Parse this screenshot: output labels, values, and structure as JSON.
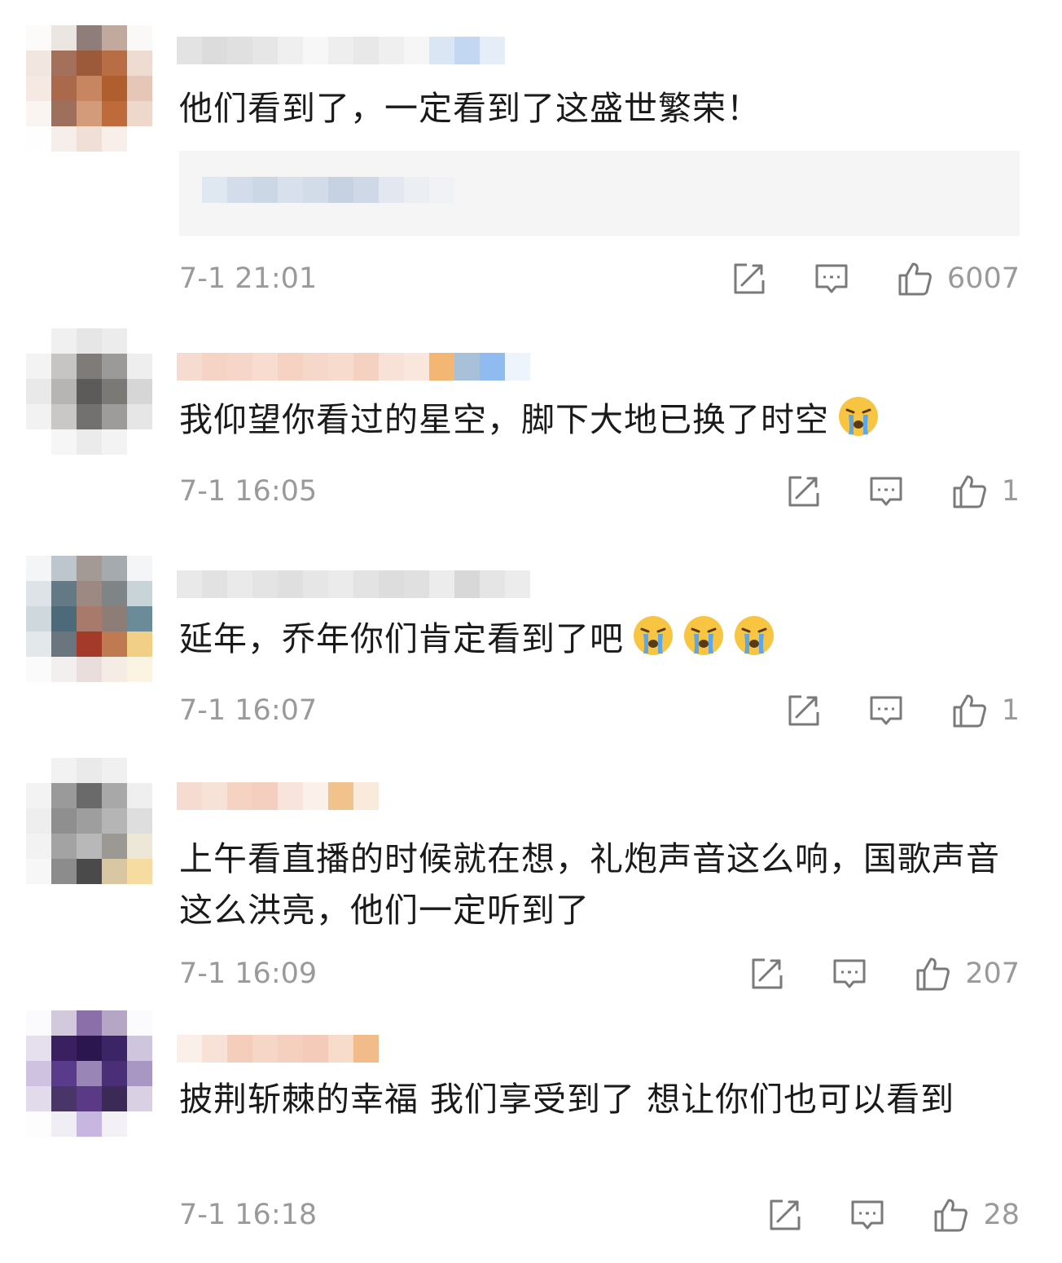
{
  "comments": [
    {
      "text": "他们看到了，一定看到了这盛世繁荣！",
      "emoji_count": 0,
      "has_reply_box": true,
      "time": "7-1 21:01",
      "likes": "6007"
    },
    {
      "text": "我仰望你看过的星空，脚下大地已换了时空",
      "emoji_count": 1,
      "has_reply_box": false,
      "time": "7-1 16:05",
      "likes": "1"
    },
    {
      "text": "延年，乔年你们肯定看到了吧",
      "emoji_count": 3,
      "has_reply_box": false,
      "time": "7-1 16:07",
      "likes": "1"
    },
    {
      "text": "上午看直播的时候就在想，礼炮声音这么响，国歌声音这么洪亮，他们一定听到了",
      "emoji_count": 0,
      "has_reply_box": false,
      "time": "7-1 16:09",
      "likes": "207"
    },
    {
      "text": "披荆斩棘的幸福 我们享受到了  想让你们也可以看到",
      "emoji_count": 0,
      "has_reply_box": false,
      "time": "7-1 16:18",
      "likes": "28"
    }
  ],
  "icons": {
    "share": "share-icon",
    "comment": "comment-icon",
    "like": "thumbs-up-icon",
    "emoji": "crying-face-emoji"
  },
  "colors": {
    "text": "#1a1a1a",
    "meta": "#9a9a9a",
    "reply_bg": "#f5f5f5"
  }
}
